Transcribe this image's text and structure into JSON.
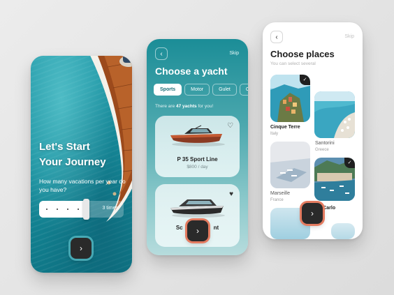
{
  "onboarding": {
    "title_line1": "Let's Start",
    "title_line2": "Your Journey",
    "question": "How many vacations per year do you have?",
    "slider": {
      "value_label": "3 times",
      "fraction": 0.55
    },
    "next_icon": "chevron-right-icon"
  },
  "yacht_screen": {
    "back_icon": "chevron-left-icon",
    "skip_label": "Skip",
    "title": "Choose a yacht",
    "categories": [
      "Sports",
      "Motor",
      "Gulet",
      "Cr"
    ],
    "active_category": "Sports",
    "count_prefix": "There are ",
    "count_value": "47 yachts",
    "count_suffix": " for you!",
    "yachts": [
      {
        "name": "P 35 Sport Line",
        "price": "$800 / day",
        "favorite": false
      },
      {
        "name": "Sc",
        "name_end": "nt",
        "favorite": true
      }
    ],
    "next_icon": "chevron-right-icon"
  },
  "places_screen": {
    "back_icon": "chevron-left-icon",
    "skip_label": "Skip",
    "title": "Choose places",
    "subtitle": "You can select several",
    "places": [
      {
        "name": "Cinque Terre",
        "country": "Italy",
        "selected": true
      },
      {
        "name": "Santorini",
        "country": "Greece",
        "selected": false
      },
      {
        "name": "Marseille",
        "country": "France",
        "selected": false
      },
      {
        "name": "e-Carlo",
        "country": "co",
        "selected": true
      }
    ],
    "next_icon": "chevron-right-icon"
  },
  "colors": {
    "accent_ring": "#e47b60",
    "teal": "#1b8d97",
    "dark_button": "#2a2a2a"
  }
}
